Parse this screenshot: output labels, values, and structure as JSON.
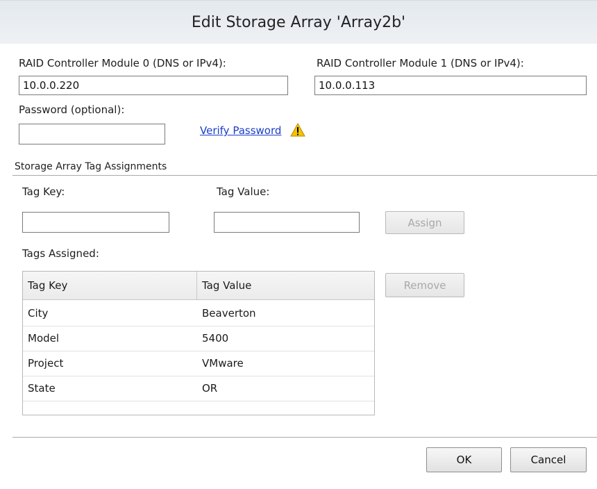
{
  "dialog": {
    "title": "Edit Storage Array 'Array2b'"
  },
  "controllers": {
    "module0_label": "RAID Controller Module 0 (DNS or IPv4):",
    "module0_value": "10.0.0.220",
    "module1_label": "RAID Controller Module 1 (DNS or IPv4):",
    "module1_value": "10.0.0.113"
  },
  "password": {
    "label": "Password (optional):",
    "value": "",
    "verify_link": "Verify Password",
    "warning_icon": "warning-triangle-icon",
    "warning_color": "#f5c400"
  },
  "tags": {
    "section_label": "Storage Array Tag Assignments",
    "key_label": "Tag Key:",
    "key_value": "",
    "value_label": "Tag Value:",
    "value_value": "",
    "assign_label": "Assign",
    "assigned_label": "Tags Assigned:",
    "remove_label": "Remove",
    "columns": [
      "Tag Key",
      "Tag Value"
    ],
    "rows": [
      {
        "key": "City",
        "value": "Beaverton"
      },
      {
        "key": "Model",
        "value": "5400"
      },
      {
        "key": "Project",
        "value": "VMware"
      },
      {
        "key": "State",
        "value": "OR"
      }
    ]
  },
  "footer": {
    "ok_label": "OK",
    "cancel_label": "Cancel"
  }
}
